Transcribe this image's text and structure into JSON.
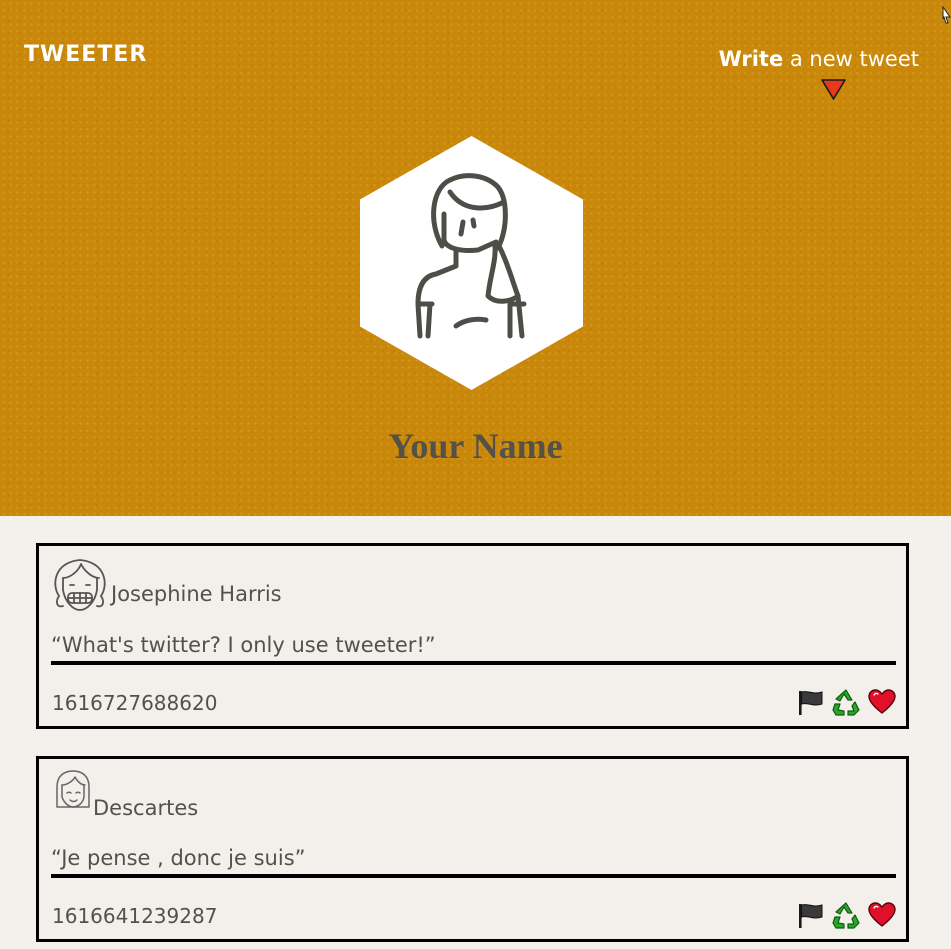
{
  "nav": {
    "brand": "TWEETER",
    "compose_bold": "Write",
    "compose_rest": " a new tweet"
  },
  "profile": {
    "name": "Your Name"
  },
  "tweets": [
    {
      "author": "Josephine Harris",
      "content": "“What's twitter? I only use tweeter!”",
      "timestamp": "1616727688620",
      "avatar_icon": "girl-grin-avatar-icon"
    },
    {
      "author": "Descartes",
      "content": "“Je pense , donc je suis”",
      "timestamp": "1616641239287",
      "avatar_icon": "bob-haircut-avatar-icon"
    }
  ],
  "actions": {
    "icons": [
      "flag-icon",
      "retweet-icon",
      "heart-icon"
    ]
  },
  "colors": {
    "header": "#c9880a",
    "page": "#f4f1ec",
    "text": "#545149",
    "arrow": "#e8391a",
    "heart": "#e0102a",
    "recycle": "#2aa72a"
  }
}
